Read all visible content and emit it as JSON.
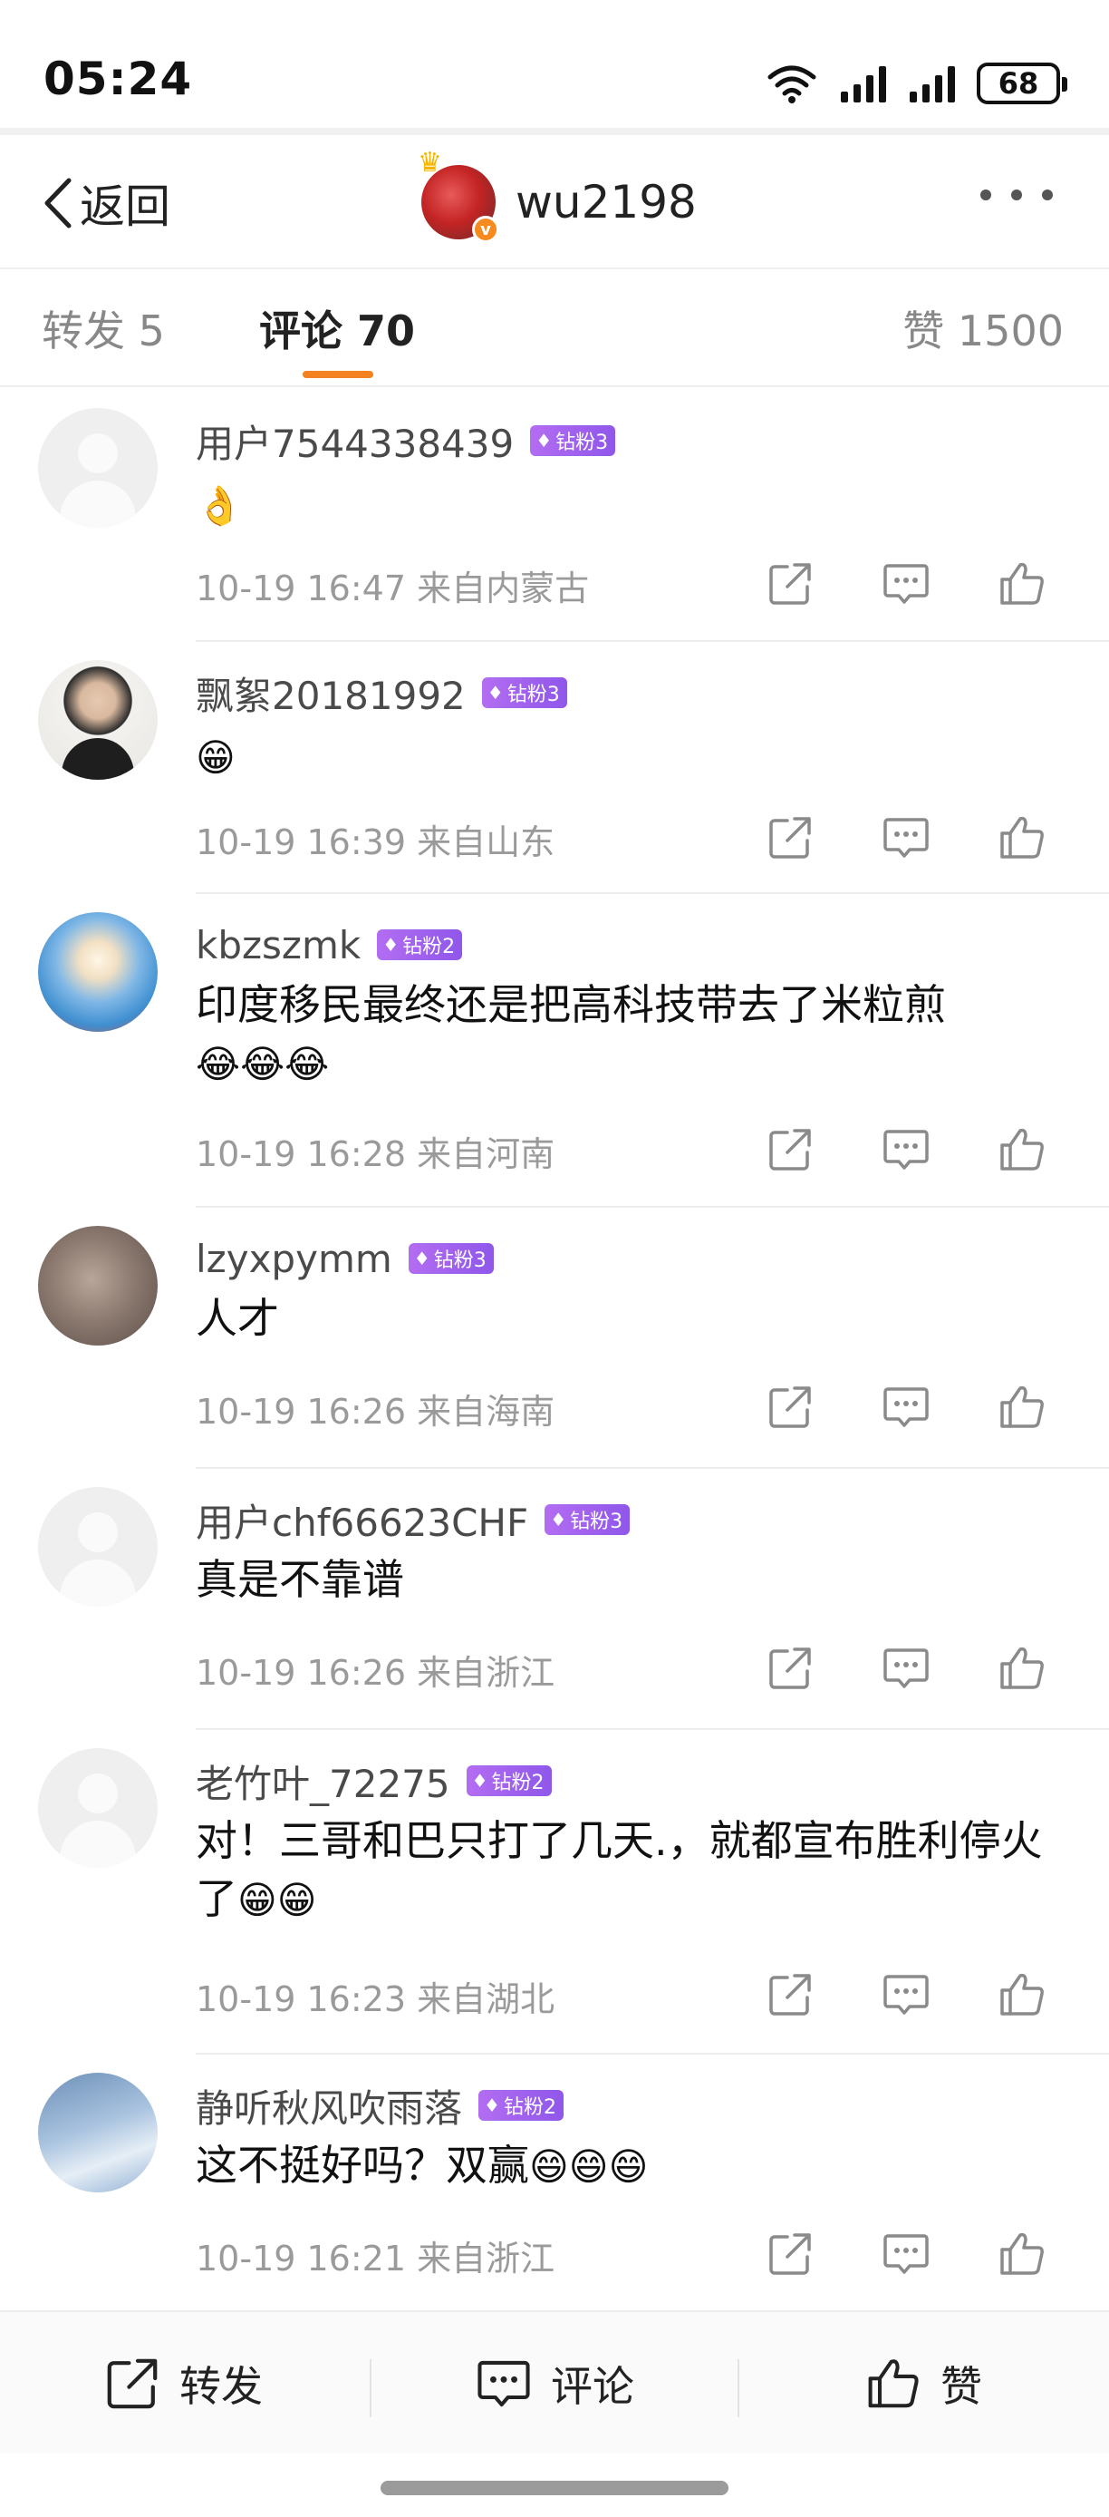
{
  "status_bar": {
    "time": "05:24",
    "battery": "68"
  },
  "nav": {
    "back_label": "返回",
    "username": "wu2198",
    "avatar_badge": "v"
  },
  "tabs": {
    "repost": "转发 5",
    "comment": "评论 70",
    "like": "赞 1500",
    "active": "comment",
    "accent_color": "#f58220"
  },
  "comments": [
    {
      "name": "用户7544338439",
      "badge": "钻粉3",
      "text": "",
      "emojis": [
        "👌"
      ],
      "meta": "10-19 16:47 来自内蒙古"
    },
    {
      "name": "飘絮20181992",
      "badge": "钻粉3",
      "text": "",
      "emojis": [
        "😁"
      ],
      "meta": "10-19 16:39 来自山东"
    },
    {
      "name": "kbzszmk",
      "badge": "钻粉2",
      "text": "印度移民最终还是把高科技带去了米粒煎",
      "emojis": [
        "😂",
        "😂",
        "😂"
      ],
      "meta": "10-19 16:28 来自河南"
    },
    {
      "name": "lzyxpymm",
      "badge": "钻粉3",
      "text": "人才",
      "emojis": [],
      "meta": "10-19 16:26 来自海南"
    },
    {
      "name": "用户chf66623CHF",
      "badge": "钻粉3",
      "text": "真是不靠谱",
      "emojis": [],
      "meta": "10-19 16:26 来自浙江"
    },
    {
      "name": "老竹叶_72275",
      "badge": "钻粉2",
      "text": "对！三哥和巴只打了几天.，就都宣布胜利停火了",
      "emojis": [
        "😁",
        "😁"
      ],
      "meta": "10-19 16:23 来自湖北"
    },
    {
      "name": "静听秋风吹雨落",
      "badge": "钻粉2",
      "text": "这不挺好吗？双赢",
      "emojis": [
        "😄",
        "😄",
        "😄"
      ],
      "meta": "10-19 16:21 来自浙江"
    }
  ],
  "bottom_bar": {
    "repost": "转发",
    "comment": "评论",
    "like": "赞"
  },
  "icons": [
    "back-chevron-icon",
    "more-icon",
    "share-icon",
    "reply-icon",
    "like-icon",
    "wifi-icon",
    "signal-icon",
    "battery-icon",
    "diamond-icon"
  ]
}
